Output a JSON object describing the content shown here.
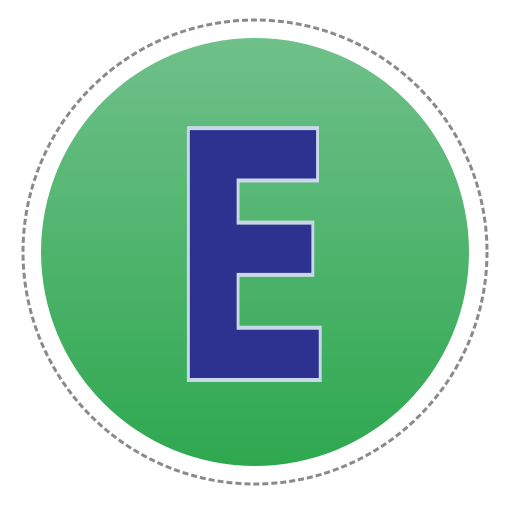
{
  "icon": {
    "name": "letter-e-badge-icon",
    "letter": "E",
    "colors": {
      "background": "#ffffff",
      "ring_outline": "#8a8a8a",
      "ring_fill": "#ffffff",
      "disc_top": "#6fc08a",
      "disc_bottom": "#2ea84f",
      "letter_fill": "#2d318f",
      "letter_outline": "#c9d8e8"
    }
  }
}
